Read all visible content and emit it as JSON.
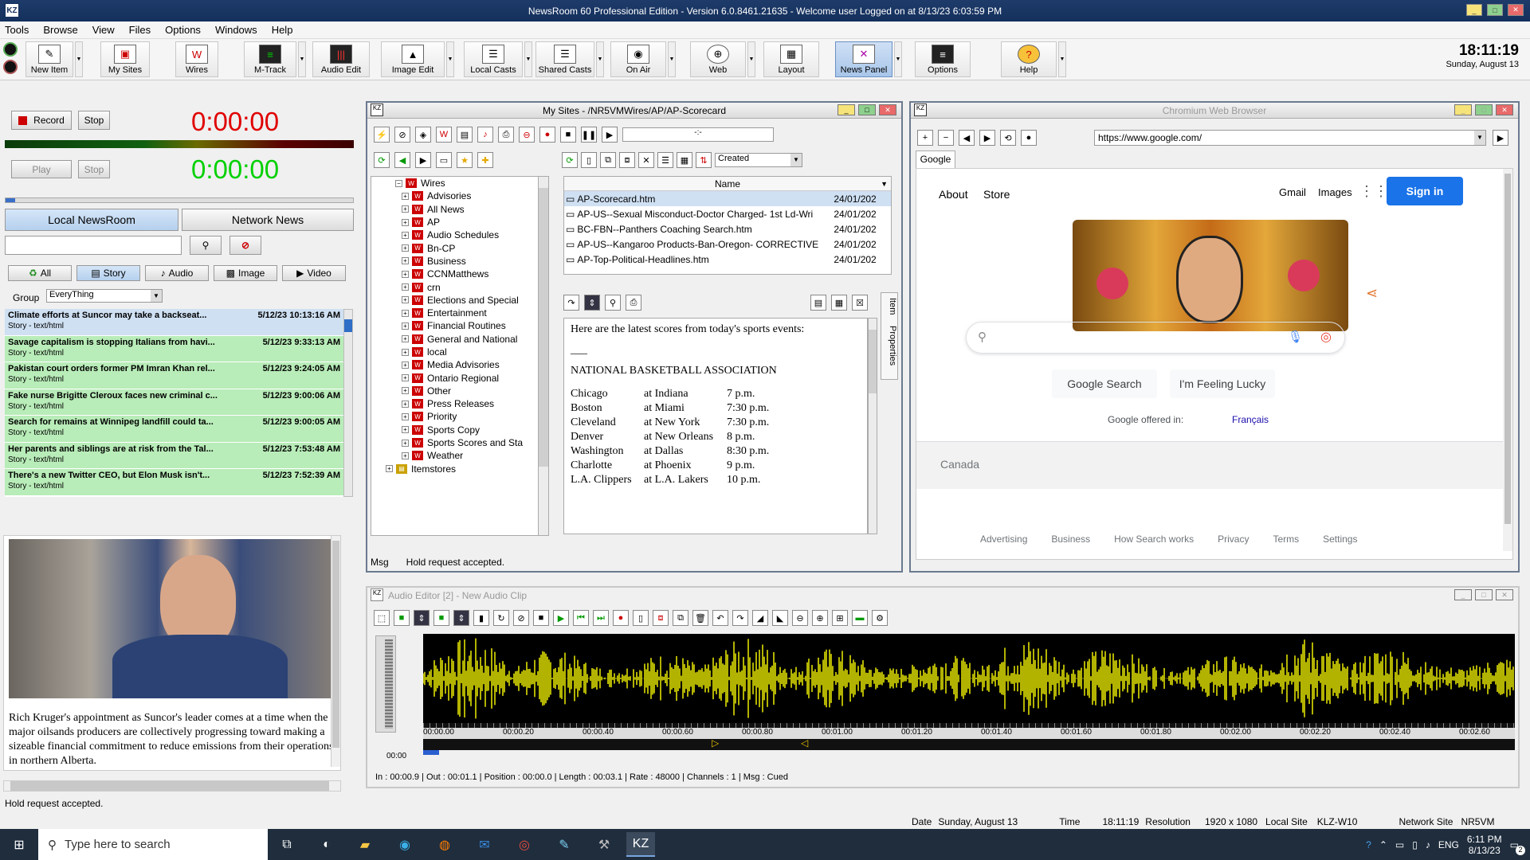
{
  "app": {
    "icon": "KZ",
    "title": "NewsRoom 60 Professional Edition - Version 6.0.8461.21635 - Welcome user  Logged on at 8/13/23 6:03:59 PM"
  },
  "menu": [
    "Tools",
    "Browse",
    "View",
    "Files",
    "Options",
    "Windows",
    "Help"
  ],
  "toolbar": [
    {
      "label": "New Item",
      "icon": "pencil-icon"
    },
    {
      "label": "My Sites",
      "icon": "sites-icon"
    },
    {
      "label": "Wires",
      "icon": "wires-icon"
    },
    {
      "label": "M-Track",
      "icon": "mtrack-icon"
    },
    {
      "label": "Audio Edit",
      "icon": "audio-edit-icon"
    },
    {
      "label": "Image Edit",
      "icon": "image-edit-icon"
    },
    {
      "label": "Local Casts",
      "icon": "local-casts-icon"
    },
    {
      "label": "Shared Casts",
      "icon": "shared-casts-icon"
    },
    {
      "label": "On Air",
      "icon": "on-air-icon"
    },
    {
      "label": "Web",
      "icon": "globe-icon"
    },
    {
      "label": "Layout",
      "icon": "layout-icon"
    },
    {
      "label": "News Panel",
      "icon": "news-panel-icon"
    },
    {
      "label": "Options",
      "icon": "options-icon"
    },
    {
      "label": "Help",
      "icon": "help-icon"
    }
  ],
  "clock": {
    "time": "18:11:19",
    "date": "Sunday, August 13"
  },
  "recorder": {
    "record_label": "Record",
    "stop_label": "Stop",
    "record_time": "0:00:00",
    "play_label": "Play",
    "stop2_label": "Stop",
    "play_time": "0:00:00"
  },
  "newsroom": {
    "tab_local": "Local NewsRoom",
    "tab_network": "Network News",
    "filters": [
      "All",
      "Story",
      "Audio",
      "Image",
      "Video"
    ],
    "group_label": "Group",
    "group_value": "EveryThing",
    "stories": [
      {
        "title": "Climate efforts at Suncor may take a backseat...",
        "time": "5/12/23 10:13:16 AM",
        "sub": "Story - text/html",
        "color": "#cfe0f3"
      },
      {
        "title": "Savage capitalism is stopping Italians from havi...",
        "time": "5/12/23 9:33:13 AM",
        "sub": "Story - text/html",
        "color": "#b8ecb8"
      },
      {
        "title": "Pakistan court orders former PM Imran Khan rel...",
        "time": "5/12/23 9:24:05 AM",
        "sub": "Story - text/html",
        "color": "#b8ecb8"
      },
      {
        "title": "Fake nurse Brigitte Cleroux faces new criminal c...",
        "time": "5/12/23 9:00:06 AM",
        "sub": "Story - text/html",
        "color": "#b8ecb8"
      },
      {
        "title": "Search for remains at Winnipeg landfill could ta...",
        "time": "5/12/23 9:00:05 AM",
        "sub": "Story - text/html",
        "color": "#b8ecb8"
      },
      {
        "title": "Her parents and siblings are at risk from the Tal...",
        "time": "5/12/23 7:53:48 AM",
        "sub": "Story - text/html",
        "color": "#b8ecb8"
      },
      {
        "title": "There's a new Twitter CEO, but Elon Musk isn't...",
        "time": "5/12/23 7:52:39 AM",
        "sub": "Story - text/html",
        "color": "#b8ecb8"
      }
    ],
    "preview_text": "Rich Kruger's appointment as Suncor's leader comes at a time when the major oilsands producers are collectively progressing toward making a sizeable financial commitment to reduce emissions from their operations in northern Alberta.",
    "status": "Hold request accepted."
  },
  "mysites": {
    "title": "My Sites - /NR5VMWires/AP/AP-Scorecard",
    "root": "Wires",
    "tree": [
      "Advisories",
      "All News",
      "AP",
      "Audio Schedules",
      "Bn-CP",
      "Business",
      "CCNMatthews",
      "crn",
      "Elections and Special",
      "Entertainment",
      "Financial Routines",
      "General and National",
      "local",
      "Media Advisories",
      "Ontario Regional",
      "Other",
      "Press Releases",
      "Priority",
      "Sports Copy",
      "Sports Scores and Sta",
      "Weather"
    ],
    "tree_last": "Itemstores",
    "sort_value": "Created",
    "col_name": "Name",
    "files": [
      {
        "name": "AP-Scorecard.htm",
        "date": "24/01/202"
      },
      {
        "name": "AP-US--Sexual Misconduct-Doctor Charged- 1st Ld-Wri",
        "date": "24/01/202"
      },
      {
        "name": "BC-FBN--Panthers Coaching Search.htm",
        "date": "24/01/202"
      },
      {
        "name": "AP-US--Kangaroo Products-Ban-Oregon- CORRECTIVE",
        "date": "24/01/202"
      },
      {
        "name": "AP-Top-Political-Headlines.htm",
        "date": "24/01/202"
      }
    ],
    "doc_intro": "Here are the latest scores from today's sports events:",
    "doc_rule": "___",
    "doc_heading": "NATIONAL BASKETBALL ASSOCIATION",
    "games": [
      {
        "team": "Chicago",
        "opp": "at Indiana",
        "time": "7 p.m."
      },
      {
        "team": "Boston",
        "opp": "at Miami",
        "time": "7:30 p.m."
      },
      {
        "team": "Cleveland",
        "opp": "at New York",
        "time": "7:30 p.m."
      },
      {
        "team": "Denver",
        "opp": "at New Orleans",
        "time": "8 p.m."
      },
      {
        "team": "Washington",
        "opp": "at Dallas",
        "time": "8:30 p.m."
      },
      {
        "team": "Charlotte",
        "opp": "at Phoenix",
        "time": "9 p.m."
      },
      {
        "team": "L.A. Clippers",
        "opp": "at L.A. Lakers",
        "time": "10 p.m."
      }
    ],
    "side_tabs": [
      "Item",
      "Properties"
    ],
    "msg_label": "Msg",
    "msg_value": "Hold request accepted."
  },
  "browser": {
    "title": "Chromium Web Browser",
    "url": "https://www.google.com/",
    "tab": "Google",
    "about": "About",
    "store": "Store",
    "gmail": "Gmail",
    "images": "Images",
    "signin": "Sign in",
    "search_btn": "Google Search",
    "lucky_btn": "I'm Feeling Lucky",
    "offered": "Google offered in:",
    "lang": "Français",
    "country": "Canada",
    "footer": [
      "Advertising",
      "Business",
      "How Search works",
      "Privacy",
      "Terms",
      "Settings"
    ]
  },
  "audio": {
    "title": "Audio Editor [2] - New Audio Clip",
    "time_label": "00:00",
    "ticks": [
      "00:00.00",
      "00:00.20",
      "00:00.40",
      "00:00.60",
      "00:00.80",
      "00:01.00",
      "00:01.20",
      "00:01.40",
      "00:01.60",
      "00:01.80",
      "00:02.00",
      "00:02.20",
      "00:02.40",
      "00:02.60"
    ],
    "status": "In : 00:00.9 | Out : 00:01.1 | Position : 00:00.0 | Length : 00:03.1 | Rate : 48000 | Channels : 1 | Msg : Cued"
  },
  "statusbar": {
    "date_label": "Date",
    "date": "Sunday, August 13",
    "time_label": "Time",
    "time": "18:11:19",
    "res_label": "Resolution",
    "res": "1920 x 1080",
    "site_label": "Local Site",
    "site": "KLZ-W10",
    "net_label": "Network Site",
    "net": "NR5VM"
  },
  "taskbar": {
    "search_placeholder": "Type here to search",
    "lang": "ENG",
    "time": "6:11 PM",
    "date": "8/13/23",
    "badge": "2"
  },
  "colors": {
    "accent": "#1e3b6a",
    "waveform": "#ffff00",
    "record_time": "#e00000",
    "play_time": "#00d000"
  }
}
